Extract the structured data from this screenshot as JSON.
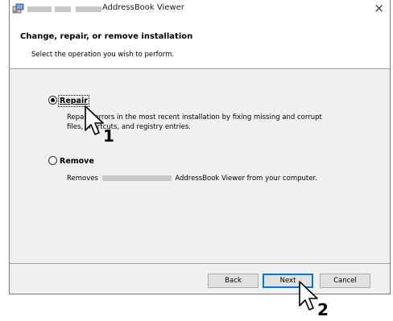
{
  "window": {
    "title_suffix": "AddressBook Viewer",
    "close_label": "×"
  },
  "header": {
    "title": "Change, repair, or remove installation",
    "subtitle": "Select the operation you wish to perform."
  },
  "options": [
    {
      "label": "Repair",
      "selected": true,
      "description_lines": [
        "Repairs errors in the most recent installation by fixing missing and corrupt",
        "files, shortcuts, and registry entries."
      ]
    },
    {
      "label": "Remove",
      "selected": false,
      "description_prefix": "Removes",
      "description_suffix": "AddressBook Viewer from your computer."
    }
  ],
  "buttons": {
    "back": "Back",
    "next": "Next",
    "cancel": "Cancel"
  },
  "annotations": {
    "step1": "1",
    "step2": "2"
  },
  "colors": {
    "focus_blue": "#0078d7",
    "dialog_bg": "#f0f0f0"
  }
}
